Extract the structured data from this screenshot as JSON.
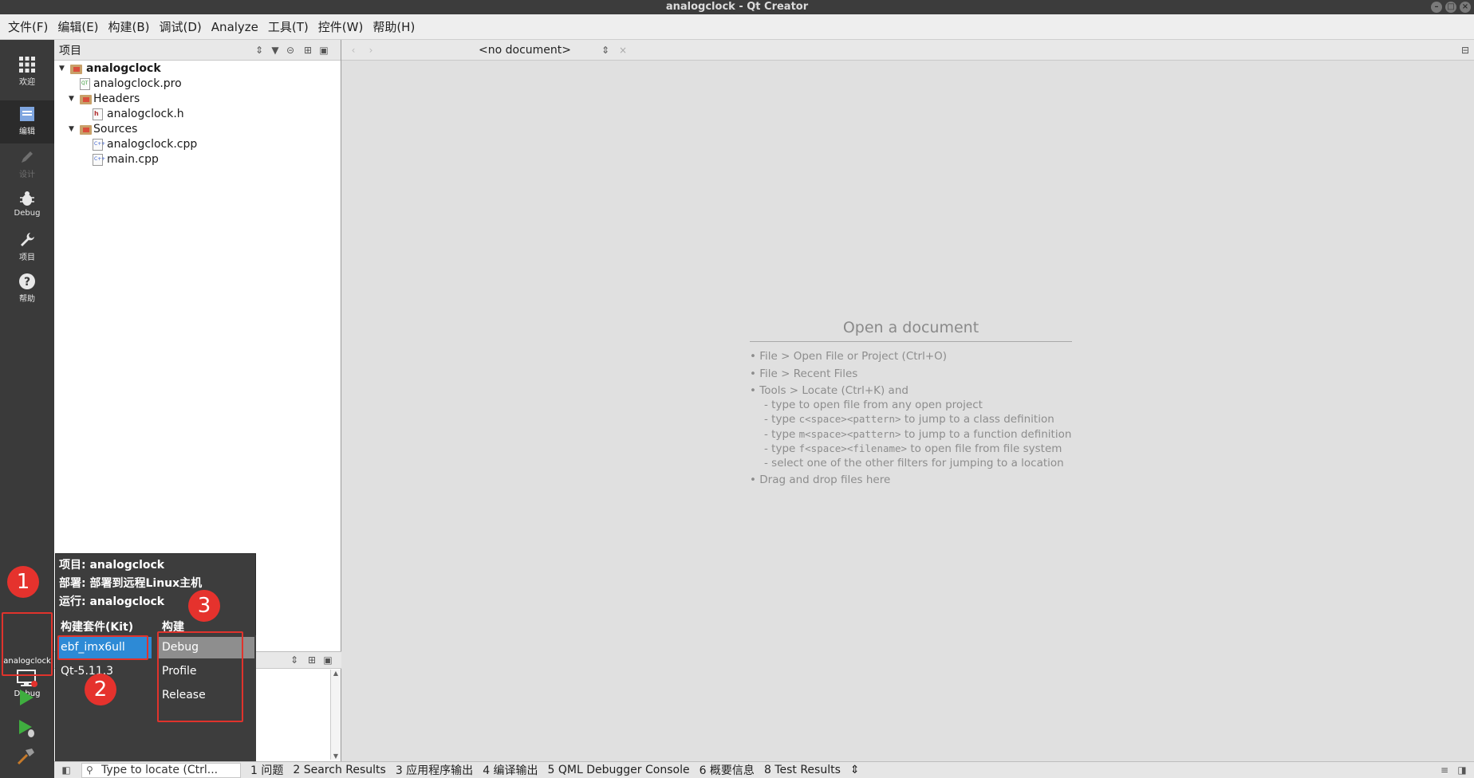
{
  "window": {
    "title": "analogclock - Qt Creator"
  },
  "menu": [
    "文件(F)",
    "编辑(E)",
    "构建(B)",
    "调试(D)",
    "Analyze",
    "工具(T)",
    "控件(W)",
    "帮助(H)"
  ],
  "modes": {
    "welcome": "欢迎",
    "edit": "编辑",
    "design": "设计",
    "debug": "Debug",
    "projects": "项目",
    "help": "帮助"
  },
  "sidebar": {
    "title": "项目",
    "tree": {
      "project": "analogclock",
      "pro_file": "analogclock.pro",
      "headers": "Headers",
      "header_file": "analogclock.h",
      "sources": "Sources",
      "source_files": [
        "analogclock.cpp",
        "main.cpp"
      ]
    }
  },
  "editor": {
    "document_combo": "<no document>",
    "open_title": "Open a document",
    "hints": {
      "file_open": "• File > Open File or Project (Ctrl+O)",
      "recent": "• File > Recent Files",
      "locate": "• Tools > Locate (Ctrl+K) and",
      "type_open": "- type to open file from any open project",
      "type_c_pre": "- type ",
      "type_c_code": "c<space><pattern>",
      "type_c_post": " to jump to a class definition",
      "type_m_pre": "- type ",
      "type_m_code": "m<space><pattern>",
      "type_m_post": " to jump to a function definition",
      "type_f_pre": "- type ",
      "type_f_code": "f<space><filename>",
      "type_f_post": " to open file from file system",
      "select_other": "- select one of the other filters for jumping to a location",
      "drag": "• Drag and drop files here"
    }
  },
  "kit_popup": {
    "project_line": "项目: analogclock",
    "deploy_line": "部署: 部署到远程Linux主机",
    "run_line": "运行: analogclock",
    "kit_header": "构建套件(Kit)",
    "build_header": "构建",
    "kits": [
      "ebf_imx6ull",
      "Qt-5.11.3"
    ],
    "builds": [
      "Debug",
      "Profile",
      "Release"
    ],
    "selected_kit": "ebf_imx6ull",
    "selected_build": "Debug"
  },
  "target_selector": {
    "project": "analogclock",
    "config": "Debug"
  },
  "annotations": [
    "1",
    "2",
    "3"
  ],
  "statusbar": {
    "locator_placeholder": "Type to locate (Ctrl...",
    "panes": [
      "1 问题",
      "2 Search Results",
      "3 应用程序输出",
      "4 编译输出",
      "5 QML Debugger Console",
      "6 概要信息",
      "8 Test Results"
    ]
  },
  "colors": {
    "accent": "#2d8ad6",
    "annotation_red": "#e0332c",
    "modebar": "#3a3a3a"
  }
}
